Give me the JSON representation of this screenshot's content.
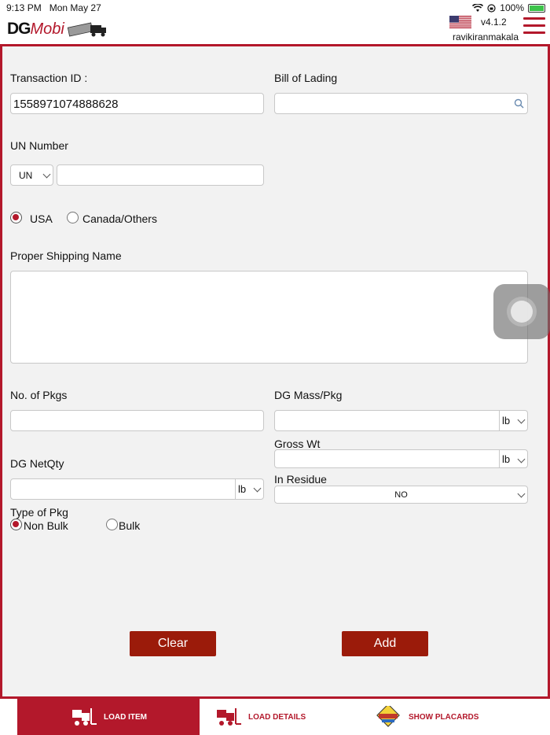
{
  "status_bar": {
    "time": "9:13 PM",
    "date": "Mon May 27",
    "battery": "100%"
  },
  "header": {
    "logo_dg": "DG",
    "logo_mobi": "Mobi",
    "version": "v4.1.2",
    "username": "ravikiranmakala"
  },
  "form": {
    "transaction_id_label": "Transaction ID :",
    "transaction_id_value": "1558971074888628",
    "bill_of_lading_label": "Bill of Lading",
    "bill_of_lading_value": "",
    "un_number_label": "UN Number",
    "un_prefix": "UN",
    "un_number_value": "",
    "region_usa": "USA",
    "region_canada": "Canada/Others",
    "proper_shipping_name_label": "Proper Shipping Name",
    "no_of_pkgs_label": "No. of Pkgs",
    "dg_mass_label": "DG Mass/Pkg",
    "dg_mass_unit": "lb",
    "gross_wt_label": "Gross Wt",
    "gross_wt_unit": "lb",
    "dg_netqty_label": "DG NetQty",
    "dg_netqty_unit": "lb",
    "in_residue_label": "In Residue",
    "in_residue_value": "NO",
    "type_of_pkg_label": "Type of Pkg",
    "non_bulk": "Non Bulk",
    "bulk": "Bulk"
  },
  "buttons": {
    "clear": "Clear",
    "add": "Add"
  },
  "tabs": [
    {
      "label": "LOAD ITEM",
      "icon": "forklift-icon",
      "active": true
    },
    {
      "label": "LOAD DETAILS",
      "icon": "forklift-icon",
      "active": false
    },
    {
      "label": "SHOW PLACARDS",
      "icon": "placard-icon",
      "active": false
    }
  ],
  "colors": {
    "brand": "#b3182b",
    "button": "#9b1b0a",
    "panel": "#f2f2f2"
  }
}
